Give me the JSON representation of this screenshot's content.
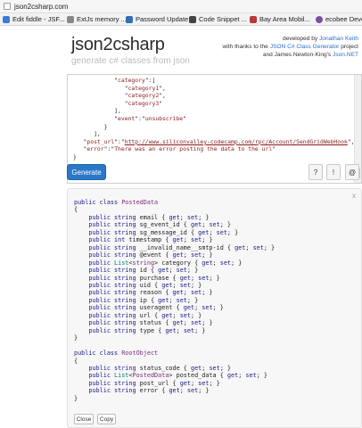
{
  "browser": {
    "url": "json2csharp.com",
    "bookmarks": [
      {
        "label": "Edit fiddle - JSF...",
        "color": "#3d7bd6"
      },
      {
        "label": "ExtJs memory ...",
        "color": "#888888"
      },
      {
        "label": "Password Update",
        "color": "#2f6fb0"
      },
      {
        "label": "Code Snippet ...",
        "color": "#444444"
      },
      {
        "label": "Bay Area Mobil...",
        "color": "#b83b3b"
      },
      {
        "label": "ecobee Devel",
        "color": "#7a4fa0"
      }
    ]
  },
  "header": {
    "title": "json2csharp",
    "subtitle": "generate c# classes from json",
    "credits": {
      "line1_prefix": "developed by ",
      "line1_link": "Jonathan Keith",
      "line2_prefix": "with thanks to the ",
      "line2_link": "JSON C# Class Generator",
      "line2_suffix": " project",
      "line3_prefix": "and James Newton-King's ",
      "line3_link": "Json.NET"
    }
  },
  "json_input": {
    "lines": [
      "            \"category\":[",
      "               \"category1\",",
      "               \"category2\",",
      "               \"category3\"",
      "            ],",
      "            \"event\":\"unsubscribe\"",
      "         }",
      "      ],",
      "   \"post_url\":\"http://www.siliconvalley-codecamp.com/rpc/Account/SendGridWebHook\",",
      "   \"error\":\"There was an error posting the data to the url\"",
      "}"
    ]
  },
  "toolbar": {
    "generate_label": "Generate",
    "help_label": "?",
    "warn_label": "!",
    "at_label": "@"
  },
  "output": {
    "close_label": "x",
    "class1_header": "public class PostedData",
    "class1_props": [
      {
        "type": "string",
        "name": "email"
      },
      {
        "type": "string",
        "name": "sg_event_id"
      },
      {
        "type": "string",
        "name": "sg_message_id"
      },
      {
        "type": "int",
        "name": "timestamp"
      },
      {
        "type": "string",
        "name": "__invalid_name__smtp-id"
      },
      {
        "type": "string",
        "name": "@event"
      },
      {
        "type": "List<string>",
        "name": "category"
      },
      {
        "type": "string",
        "name": "id"
      },
      {
        "type": "string",
        "name": "purchase"
      },
      {
        "type": "string",
        "name": "uid"
      },
      {
        "type": "string",
        "name": "reason"
      },
      {
        "type": "string",
        "name": "ip"
      },
      {
        "type": "string",
        "name": "useragent"
      },
      {
        "type": "string",
        "name": "url"
      },
      {
        "type": "string",
        "name": "status"
      },
      {
        "type": "string",
        "name": "type"
      }
    ],
    "class2_header": "public class RootObject",
    "class2_props": [
      {
        "type": "string",
        "name": "status_code"
      },
      {
        "type": "List<PostedData>",
        "name": "posted_data"
      },
      {
        "type": "string",
        "name": "post_url"
      },
      {
        "type": "string",
        "name": "error"
      }
    ],
    "close_button": "Close",
    "copy_button": "Copy"
  }
}
